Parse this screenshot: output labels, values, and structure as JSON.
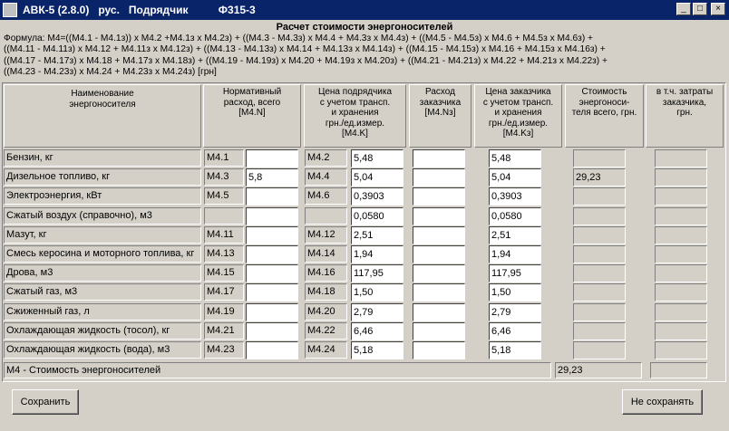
{
  "window": {
    "title": "АВК-5 (2.8.0)   рус.   Подрядчик          Ф315-3",
    "min": "_",
    "max": "□",
    "close": "×"
  },
  "heading": "Расчет стоимости энергоносителей",
  "formula": [
    "Формула: М4=((М4.1 - М4.1з)) x М4.2 +М4.1з x М4.2з) +  ((М4.3 - М4.3з) x М4.4 + М4.3з x М4.4з) +  ((М4.5 - М4.5з) x М4.6 + М4.5з x М4.6з) +",
    "((М4.11 - М4.11з) x М4.12 + М4.11з x М4.12з)  +  ((М4.13 - М4.13з) x М4.14 + М4.13з x М4.14з)   +  ((М4.15 - М4.15з) x М4.16 + М4.15з x М4.16з) +",
    "((М4.17 - М4.17з) x М4.18 + М4.17з x М4.18з) +  ((М4.19 - М4.19з) x М4.20 + М4.19з x М4.20з)  + ((М4.21 - М4.21з) x М4.22 + М4.21з x М4.22з)  +",
    "((М4.23 - М4.23з) x М4.24 + М4.23з x М4.24з) [грн]"
  ],
  "headers": {
    "name": "Наименование\nэнергоносителя",
    "norm": "Нормативный\nрасход, всего\n[М4.N]",
    "price": "Цена подрядчика\nс учетом трансп.\nи хранения\nгрн./ед.измер.\n[М4.K]",
    "cust_use": "Расход\nзаказчика\n[М4.Nз]",
    "cust_price": "Цена заказчика\nс учетом трансп.\nи хранения\nгрн./ед.измер.\n[М4.Kз]",
    "cost": "Стоимость\nэнергоноси-\nтеля всего, грн.",
    "incl": "в т.ч. затраты\nзаказчика,\nгрн."
  },
  "rows": [
    {
      "name": "Бензин, кг",
      "code1": "М4.1",
      "qty": "",
      "code2": "М4.2",
      "price": "5,48",
      "cust_use": "",
      "cust_price": "5,48",
      "cost": "",
      "incl": ""
    },
    {
      "name": "Дизельное топливо, кг",
      "code1": "М4.3",
      "qty": "5,8",
      "code2": "М4.4",
      "price": "5,04",
      "cust_use": "",
      "cust_price": "5,04",
      "cost": "29,23",
      "incl": ""
    },
    {
      "name": "Электроэнергия, кВт",
      "code1": "М4.5",
      "qty": "",
      "code2": "М4.6",
      "price": "0,3903",
      "cust_use": "",
      "cust_price": "0,3903",
      "cost": "",
      "incl": ""
    },
    {
      "name": "Сжатый воздух (справочно), м3",
      "code1": "",
      "qty": "",
      "code2": "",
      "price": "0,0580",
      "cust_use": "",
      "cust_price": "0,0580",
      "cost": "",
      "incl": ""
    },
    {
      "name": "Мазут, кг",
      "code1": "М4.11",
      "qty": "",
      "code2": "М4.12",
      "price": "2,51",
      "cust_use": "",
      "cust_price": "2,51",
      "cost": "",
      "incl": ""
    },
    {
      "name": "Смесь керосина и моторного топлива, кг",
      "code1": "М4.13",
      "qty": "",
      "code2": "М4.14",
      "price": "1,94",
      "cust_use": "",
      "cust_price": "1,94",
      "cost": "",
      "incl": ""
    },
    {
      "name": "Дрова, м3",
      "code1": "М4.15",
      "qty": "",
      "code2": "М4.16",
      "price": "117,95",
      "cust_use": "",
      "cust_price": "117,95",
      "cost": "",
      "incl": ""
    },
    {
      "name": "Сжатый газ, м3",
      "code1": "М4.17",
      "qty": "",
      "code2": "М4.18",
      "price": "1,50",
      "cust_use": "",
      "cust_price": "1,50",
      "cost": "",
      "incl": ""
    },
    {
      "name": "Сжиженный газ, л",
      "code1": "М4.19",
      "qty": "",
      "code2": "М4.20",
      "price": "2,79",
      "cust_use": "",
      "cust_price": "2,79",
      "cost": "",
      "incl": ""
    },
    {
      "name": "Охлаждающая жидкость (тосол), кг",
      "code1": "М4.21",
      "qty": "",
      "code2": "М4.22",
      "price": "6,46",
      "cust_use": "",
      "cust_price": "6,46",
      "cost": "",
      "incl": ""
    },
    {
      "name": "Охлаждающая жидкость (вода), м3",
      "code1": "М4.23",
      "qty": "",
      "code2": "М4.24",
      "price": "5,18",
      "cust_use": "",
      "cust_price": "5,18",
      "cost": "",
      "incl": ""
    }
  ],
  "total": {
    "label": "М4 - Стоимость энергоносителей",
    "value": "29,23",
    "incl": ""
  },
  "buttons": {
    "save": "Сохранить",
    "nosave": "Не сохранять"
  }
}
